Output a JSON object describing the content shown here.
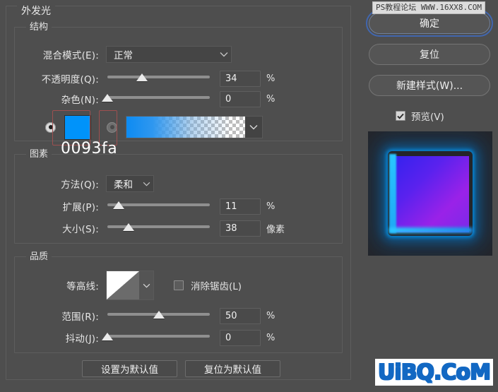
{
  "dialog": {
    "title": "外发光",
    "sections": {
      "structure": {
        "title": "结构",
        "blend_mode": {
          "label": "混合模式(E):",
          "value": "正常"
        },
        "opacity": {
          "label": "不透明度(Q):",
          "value": "34",
          "unit": "%",
          "percent": 34
        },
        "noise": {
          "label": "杂色(N):",
          "value": "0",
          "unit": "%",
          "percent": 0
        },
        "fill_type": {
          "color_selected": true,
          "color_hex": "#0093fa",
          "hex_label": "0093fa",
          "gradient_selected": false
        }
      },
      "elements": {
        "title": "图素",
        "technique": {
          "label": "方法(Q):",
          "value": "柔和"
        },
        "spread": {
          "label": "扩展(P):",
          "value": "11",
          "unit": "%",
          "percent": 11
        },
        "size": {
          "label": "大小(S):",
          "value": "38",
          "unit": "像素",
          "percent": 21
        }
      },
      "quality": {
        "title": "品质",
        "contour": {
          "label": "等高线:"
        },
        "anti_alias": {
          "label": "消除锯齿(L)",
          "checked": false
        },
        "range": {
          "label": "范围(R):",
          "value": "50",
          "unit": "%",
          "percent": 50
        },
        "jitter": {
          "label": "抖动(J):",
          "value": "0",
          "unit": "%",
          "percent": 0
        }
      }
    },
    "footer": {
      "make_default": "设置为默认值",
      "reset_default": "复位为默认值"
    }
  },
  "side": {
    "ok": "确定",
    "reset": "复位",
    "new_style": "新建样式(W)...",
    "preview": {
      "label": "预览(V)",
      "checked": true
    }
  },
  "watermarks": {
    "top": "PS教程论坛 WWW.16XX8.COM",
    "bottom": "UiBQ.CoM"
  },
  "colors": {
    "background": "#4e4e4e",
    "accent_blue": "#0093fa",
    "focus_ring": "#3f6bbf",
    "watermark_blue": "#1268c3"
  }
}
